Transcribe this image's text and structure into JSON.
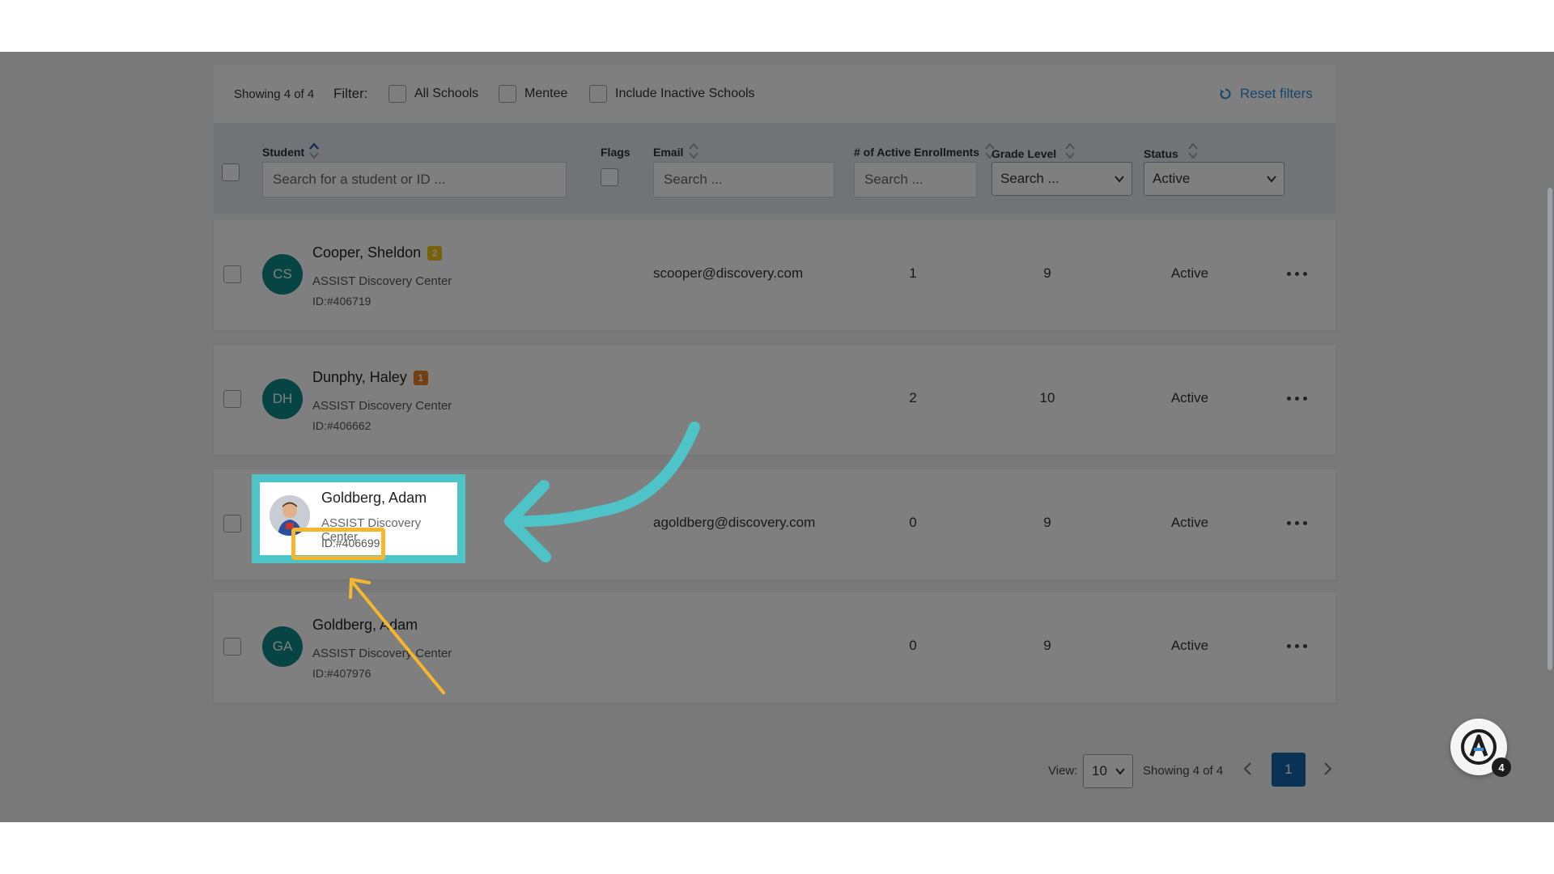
{
  "filters": {
    "showing": "Showing 4 of 4",
    "label": "Filter:",
    "options": [
      "All Schools",
      "Mentee",
      "Include Inactive Schools"
    ],
    "reset": "Reset filters"
  },
  "columns": {
    "student": "Student",
    "flags": "Flags",
    "email": "Email",
    "enrollments": "# of Active Enrollments",
    "grade": "Grade Level",
    "status": "Status"
  },
  "search": {
    "student_placeholder": "Search for a student or ID ...",
    "email_placeholder": "Search ...",
    "enrollments_placeholder": "Search ...",
    "grade_value": "Search ...",
    "status_value": "Active"
  },
  "rows": [
    {
      "initials": "CS",
      "name": "Cooper, Sheldon",
      "flag": "2",
      "flag_color": "#f1c40f",
      "school": "ASSIST Discovery Center",
      "id": "ID:#406719",
      "email": "scooper@discovery.com",
      "enrollments": "1",
      "grade": "9",
      "status": "Active"
    },
    {
      "initials": "DH",
      "name": "Dunphy, Haley",
      "flag": "1",
      "flag_color": "#e67e22",
      "school": "ASSIST Discovery Center",
      "id": "ID:#406662",
      "email": "",
      "enrollments": "2",
      "grade": "10",
      "status": "Active"
    },
    {
      "initials": "",
      "name": "Goldberg, Adam",
      "flag": "",
      "school": "ASSIST Discovery Center",
      "id": "ID:#406699",
      "email": "agoldberg@discovery.com",
      "enrollments": "0",
      "grade": "9",
      "status": "Active"
    },
    {
      "initials": "GA",
      "name": "Goldberg, Adam",
      "flag": "",
      "school": "ASSIST Discovery Center",
      "id": "ID:#407976",
      "email": "",
      "enrollments": "0",
      "grade": "9",
      "status": "Active"
    }
  ],
  "pagination": {
    "view_label": "View:",
    "page_size": "10",
    "showing": "Showing 4 of 4",
    "current_page": "1"
  },
  "widget": {
    "badge": "4"
  },
  "colors": {
    "avatar": "#0f8a88",
    "accent": "#2f8dd8",
    "highlight_frame": "#4fc4c8",
    "arrow_teal": "#4fc4c8",
    "arrow_orange": "#f4b72d",
    "page_active": "#1565a8"
  }
}
